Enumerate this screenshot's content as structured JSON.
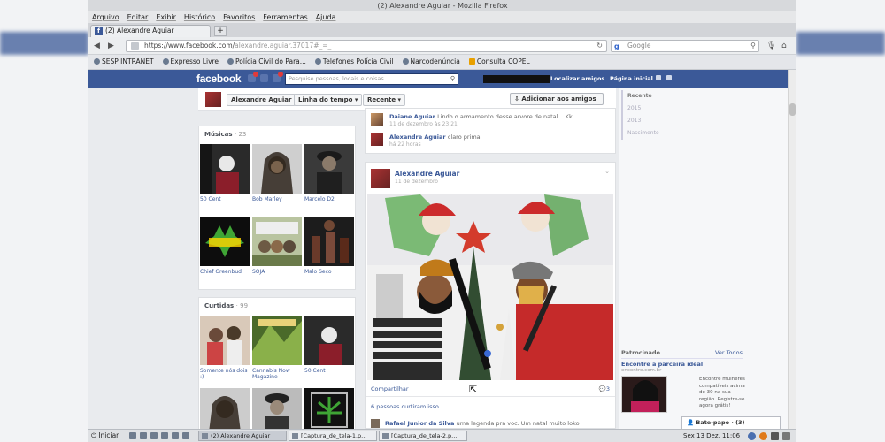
{
  "window": {
    "title": "(2) Alexandre Aguiar - Mozilla Firefox",
    "menu": [
      "Arquivo",
      "Editar",
      "Exibir",
      "Histórico",
      "Favoritos",
      "Ferramentas",
      "Ajuda"
    ],
    "tab_label": "(2) Alexandre Aguiar",
    "new_tab": "+"
  },
  "nav": {
    "back": "◀",
    "forward": "▶",
    "url_main": "https://www.facebook.com/",
    "url_rest": "alexandre.aguiar.37017#_=_",
    "search_placeholder": "Google",
    "search_engine": "g"
  },
  "bookmarks": [
    "SESP INTRANET",
    "Expresso Livre",
    "Polícia Civil do Para...",
    "Telefones Polícia Civil",
    "Narcodenúncia",
    "Consulta COPEL"
  ],
  "facebook": {
    "logo": "facebook",
    "search_placeholder": "Pesquise pessoas, locais e coisas",
    "find_friends": "Localizar amigos",
    "home": "Página inicial"
  },
  "profile": {
    "name": "Alexandre Aguiar",
    "timeline_btn": "Linha do tempo ▾",
    "recent_btn": "Recente ▾",
    "add_friend": "Adicionar aos amigos"
  },
  "music": {
    "title": "Músicas",
    "count": "· 23",
    "items": [
      "50 Cent",
      "Bob Marley",
      "Marcelo D2",
      "Chief Greenbud",
      "SOJA",
      "Malo Seco"
    ]
  },
  "likes": {
    "title": "Curtidas",
    "count": "· 99",
    "items": [
      "Somente nós dois :)",
      "Cannabis Now Magazine",
      "50 Cent"
    ]
  },
  "comments": [
    {
      "name": "Daiane Aguiar",
      "text": "Lindo o armamento desse arvore de natal....Kk",
      "time": "11 de dezembro às 23:21"
    },
    {
      "name": "Alexandre Aguiar",
      "text": "claro prima",
      "time": "há 22 horas"
    }
  ],
  "post": {
    "author": "Alexandre Aguiar",
    "date": "11 de dezembro",
    "share": "Compartilhar",
    "comments": "3",
    "likes": "6 pessoas curtiram isso.",
    "last_comment_name": "Rafael Junior da Silva",
    "last_comment_text": "uma legenda pra voc. Um natal muito loko"
  },
  "timeline_years": [
    "Recente",
    "2015",
    "2013",
    "Nascimento"
  ],
  "sponsored": {
    "header": "Patrocinado",
    "see_all": "Ver Todos",
    "title": "Encontre a parceira ideal",
    "sub": "encontre.com.br",
    "text": "Encontre mulheres compatíveis acima de 30 na sua região. Registre-se agora grátis!"
  },
  "chat": {
    "label": "Bate-papo · (3)"
  },
  "taskbar": {
    "start": "Iniciar",
    "tasks": [
      "(2) Alexandre Aguiar",
      "[Captura_de_tela-1.p...",
      "[Captura_de_tela-2.p..."
    ],
    "clock": "Sex 13 Dez, 11:06"
  },
  "colors": {
    "facebook_blue": "#3b5998",
    "link": "#3b5998",
    "page_bg": "#e9ebee"
  },
  "icons": {
    "user": "person-icon",
    "friends": "friends-icon",
    "gear": "gear-icon"
  }
}
